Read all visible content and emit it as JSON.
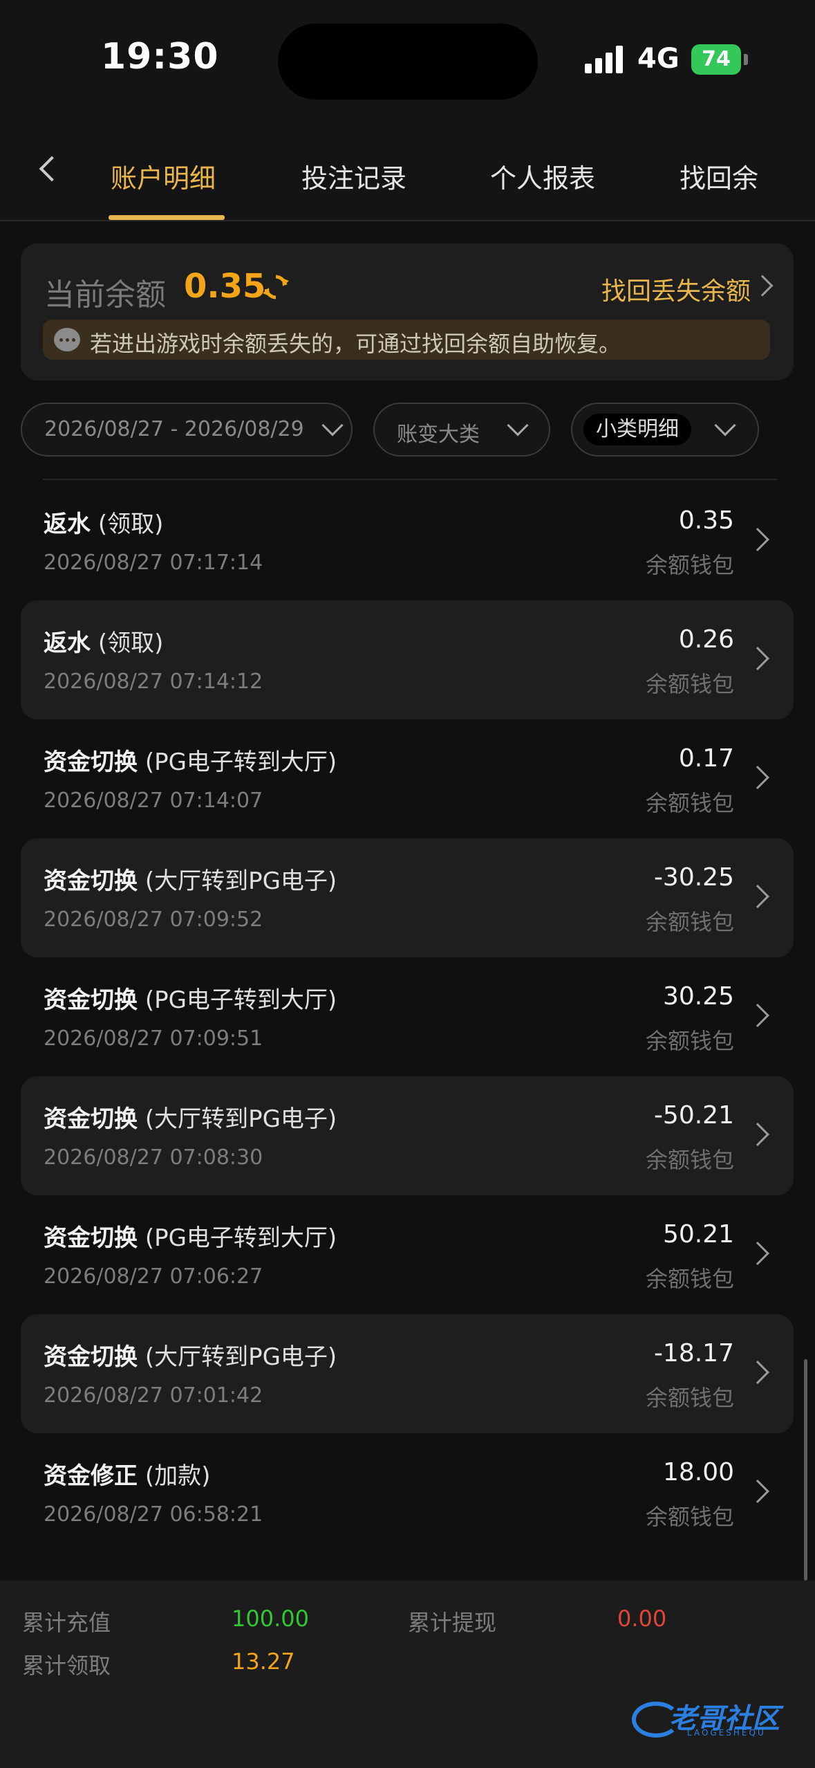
{
  "status_bar": {
    "time": "19:30",
    "network": "4G",
    "battery": "74"
  },
  "tabs": [
    {
      "label": "账户明细",
      "active": true
    },
    {
      "label": "投注记录",
      "active": false
    },
    {
      "label": "个人报表",
      "active": false
    },
    {
      "label": "找回余",
      "active": false
    }
  ],
  "balance": {
    "label": "当前余额",
    "value": "0.35",
    "recover_link": "找回丢失余额",
    "notice": "若进出游戏时余额丢失的，可通过找回余额自助恢复。"
  },
  "filters": {
    "date_range": "2026/08/27 - 2026/08/29",
    "category": "账变大类",
    "subcategory": "小类明细"
  },
  "transactions": [
    {
      "type": "返水",
      "detail": "(领取)",
      "date": "2026/08/27 07:17:14",
      "amount": "0.35",
      "wallet": "余额钱包"
    },
    {
      "type": "返水",
      "detail": "(领取)",
      "date": "2026/08/27 07:14:12",
      "amount": "0.26",
      "wallet": "余额钱包"
    },
    {
      "type": "资金切换",
      "detail": "(PG电子转到大厅)",
      "date": "2026/08/27 07:14:07",
      "amount": "0.17",
      "wallet": "余额钱包"
    },
    {
      "type": "资金切换",
      "detail": "(大厅转到PG电子)",
      "date": "2026/08/27 07:09:52",
      "amount": "-30.25",
      "wallet": "余额钱包"
    },
    {
      "type": "资金切换",
      "detail": "(PG电子转到大厅)",
      "date": "2026/08/27 07:09:51",
      "amount": "30.25",
      "wallet": "余额钱包"
    },
    {
      "type": "资金切换",
      "detail": "(大厅转到PG电子)",
      "date": "2026/08/27 07:08:30",
      "amount": "-50.21",
      "wallet": "余额钱包"
    },
    {
      "type": "资金切换",
      "detail": "(PG电子转到大厅)",
      "date": "2026/08/27 07:06:27",
      "amount": "50.21",
      "wallet": "余额钱包"
    },
    {
      "type": "资金切换",
      "detail": "(大厅转到PG电子)",
      "date": "2026/08/27 07:01:42",
      "amount": "-18.17",
      "wallet": "余额钱包"
    },
    {
      "type": "资金修正",
      "detail": "(加款)",
      "date": "2026/08/27 06:58:21",
      "amount": "18.00",
      "wallet": "余额钱包"
    }
  ],
  "summary": {
    "total_deposit_label": "累计充值",
    "total_deposit": "100.00",
    "total_withdraw_label": "累计提现",
    "total_withdraw": "0.00",
    "total_claimed_label": "累计领取",
    "total_claimed": "13.27"
  },
  "watermark": {
    "text": "老哥社区",
    "sub": "LAOGESHEQU"
  },
  "colors": {
    "accent": "#e8b64c",
    "balance": "#f3a51a",
    "deposit": "#32c832",
    "withdraw": "#e0473b"
  }
}
